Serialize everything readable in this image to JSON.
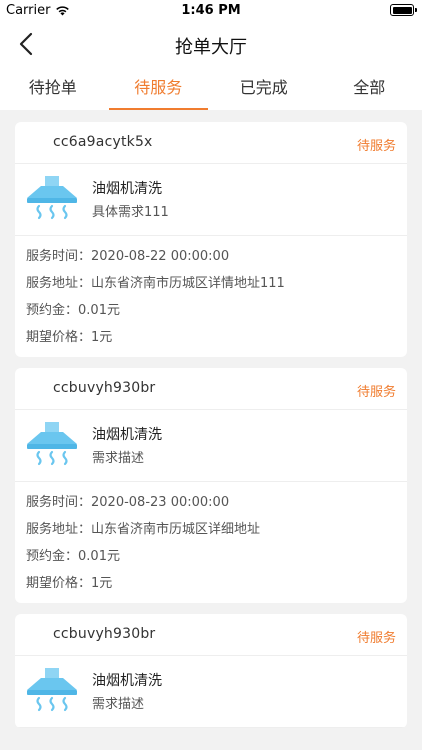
{
  "status_bar": {
    "carrier": "Carrier",
    "time": "1:46 PM"
  },
  "nav": {
    "title": "抢单大厅"
  },
  "tabs": [
    {
      "label": "待抢单",
      "active": false
    },
    {
      "label": "待服务",
      "active": true
    },
    {
      "label": "已完成",
      "active": false
    },
    {
      "label": "全部",
      "active": false
    }
  ],
  "labels": {
    "service_time": "服务时间：",
    "service_address": "服务地址：",
    "deposit": "预约金：",
    "expected_price": "期望价格："
  },
  "orders": [
    {
      "order_no": "cc6a9acytk5x",
      "status": "待服务",
      "service_name": "油烟机清洗",
      "description": "具体需求111",
      "service_time": "2020-08-22 00:00:00",
      "address": "山东省济南市历城区详情地址111",
      "deposit": "0.01元",
      "expected_price": "1元"
    },
    {
      "order_no": "ccbuvyh930br",
      "status": "待服务",
      "service_name": "油烟机清洗",
      "description": "需求描述",
      "service_time": "2020-08-23 00:00:00",
      "address": "山东省济南市历城区详细地址",
      "deposit": "0.01元",
      "expected_price": "1元"
    },
    {
      "order_no": "ccbuvyh930br",
      "status": "待服务",
      "service_name": "油烟机清洗",
      "description": "需求描述",
      "service_time": "",
      "address": "",
      "deposit": "",
      "expected_price": ""
    }
  ],
  "colors": {
    "accent": "#f07c2f",
    "background": "#f2f2f2",
    "icon": "#6ac6ef"
  },
  "icons": {
    "service": "range-hood-icon",
    "back": "chevron-left-icon",
    "wifi": "wifi-icon",
    "battery": "battery-icon"
  }
}
